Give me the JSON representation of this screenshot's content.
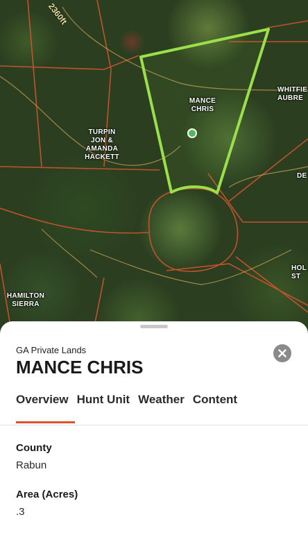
{
  "map": {
    "elevation_label": "2360ft",
    "labels": [
      {
        "key": "mance",
        "text": "MANCE CHRIS"
      },
      {
        "key": "turpin",
        "text": "TURPIN JON & AMANDA HACKETT"
      },
      {
        "key": "whitfield",
        "text": "WHITFIE AUBRE"
      },
      {
        "key": "de",
        "text": "DE"
      },
      {
        "key": "hol",
        "text": "HOL ST"
      },
      {
        "key": "hamilton",
        "text": "HAMILTON SIERRA"
      }
    ],
    "selected_parcel_color": "#9be04a",
    "boundary_color": "#d2552f",
    "pin_color": "#53b85a"
  },
  "sheet": {
    "eyebrow": "GA Private Lands",
    "title": "MANCE CHRIS",
    "tabs": [
      {
        "label": "Overview",
        "active": true
      },
      {
        "label": "Hunt Unit",
        "active": false
      },
      {
        "label": "Weather",
        "active": false
      },
      {
        "label": "Content",
        "active": false
      }
    ],
    "accent_color": "#e0532a",
    "fields": [
      {
        "label": "County",
        "value": "Rabun"
      },
      {
        "label": "Area (Acres)",
        "value": ".3"
      }
    ]
  }
}
